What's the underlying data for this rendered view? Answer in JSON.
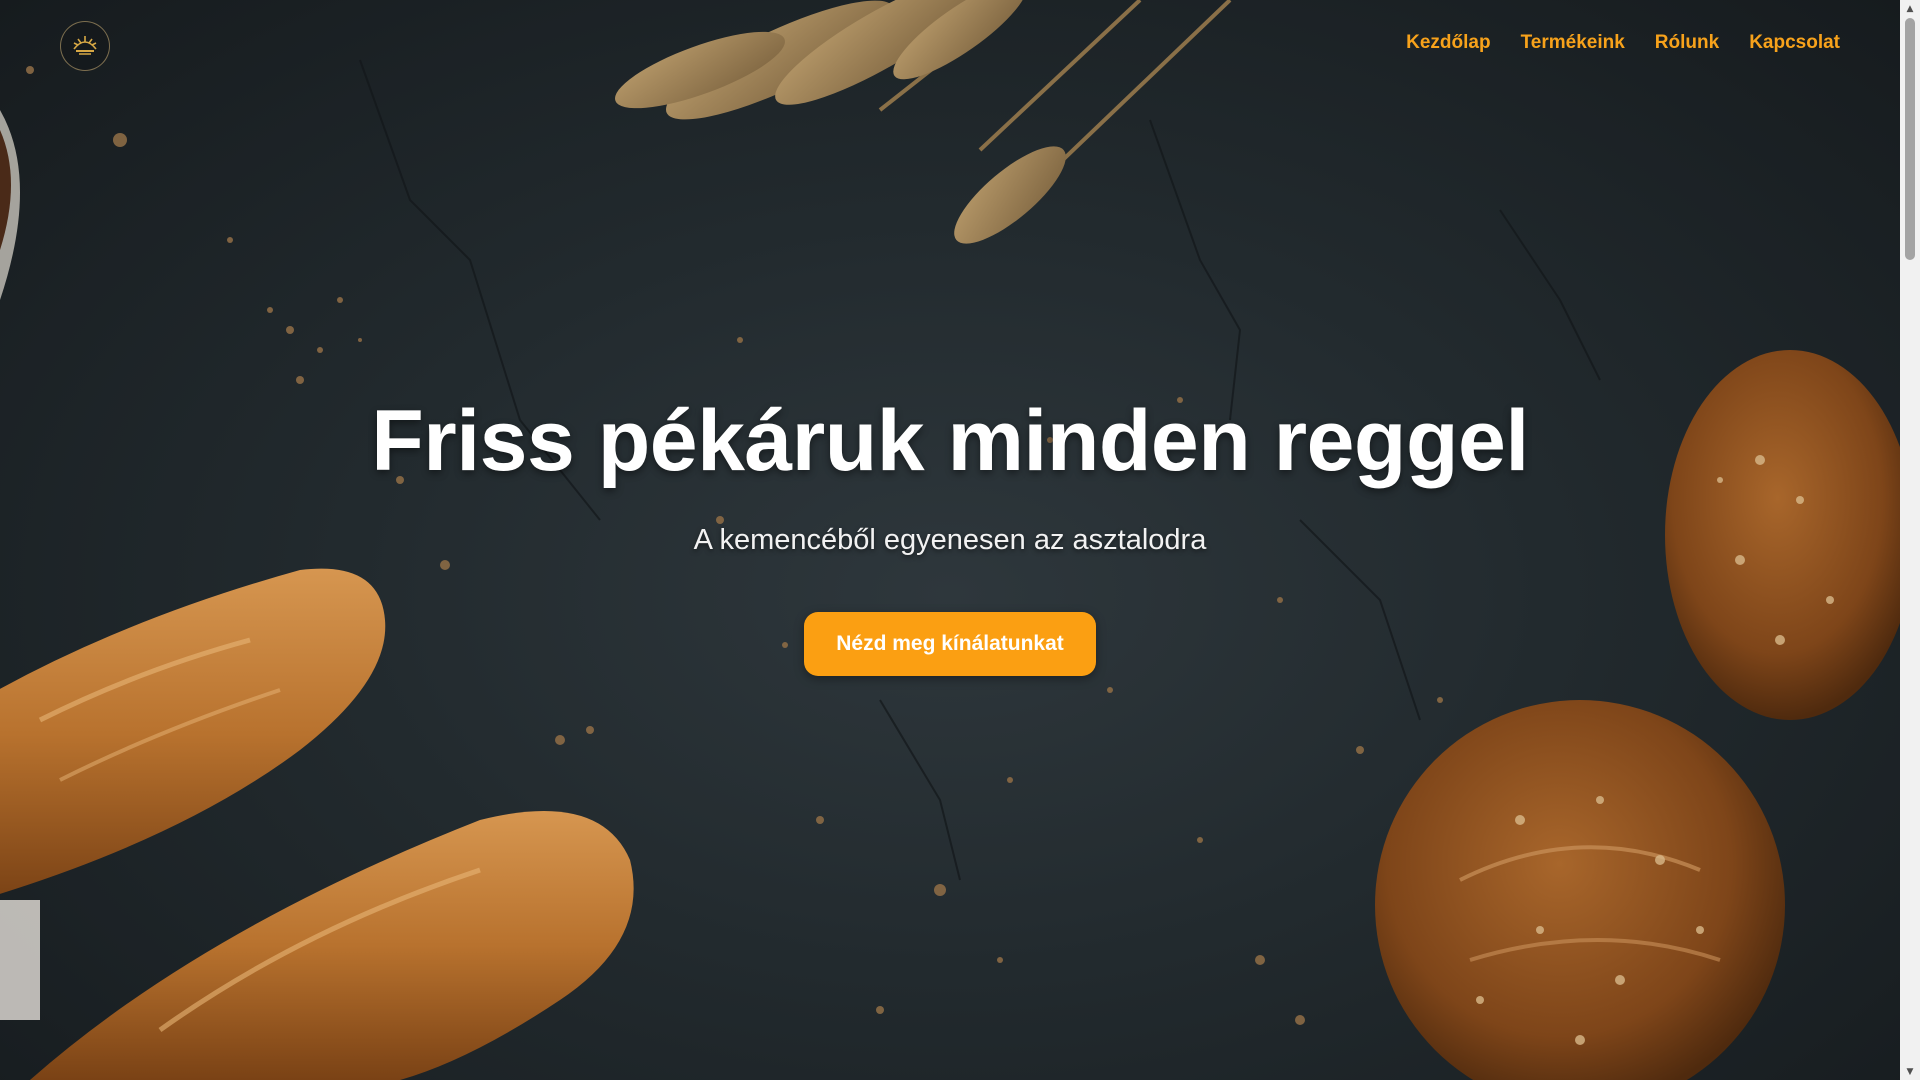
{
  "header": {
    "logo_icon": "wheat-sun-logo-icon",
    "nav": [
      {
        "label": "Kezdőlap"
      },
      {
        "label": "Termékeink"
      },
      {
        "label": "Rólunk"
      },
      {
        "label": "Kapcsolat"
      }
    ]
  },
  "hero": {
    "title": "Friss pékáruk minden reggel",
    "subtitle": "A kemencéből egyenesen az asztalodra",
    "cta_label": "Nézd meg kínálatunkat",
    "background": "dark-stone-bakery-photo"
  },
  "colors": {
    "accent": "#fb9f12",
    "nav_text": "#f7a21b",
    "background": "#222a2e",
    "title_text": "#ffffff"
  },
  "scrollbar": {
    "up_icon": "scroll-up-arrow-icon",
    "down_icon": "scroll-down-arrow-icon"
  }
}
